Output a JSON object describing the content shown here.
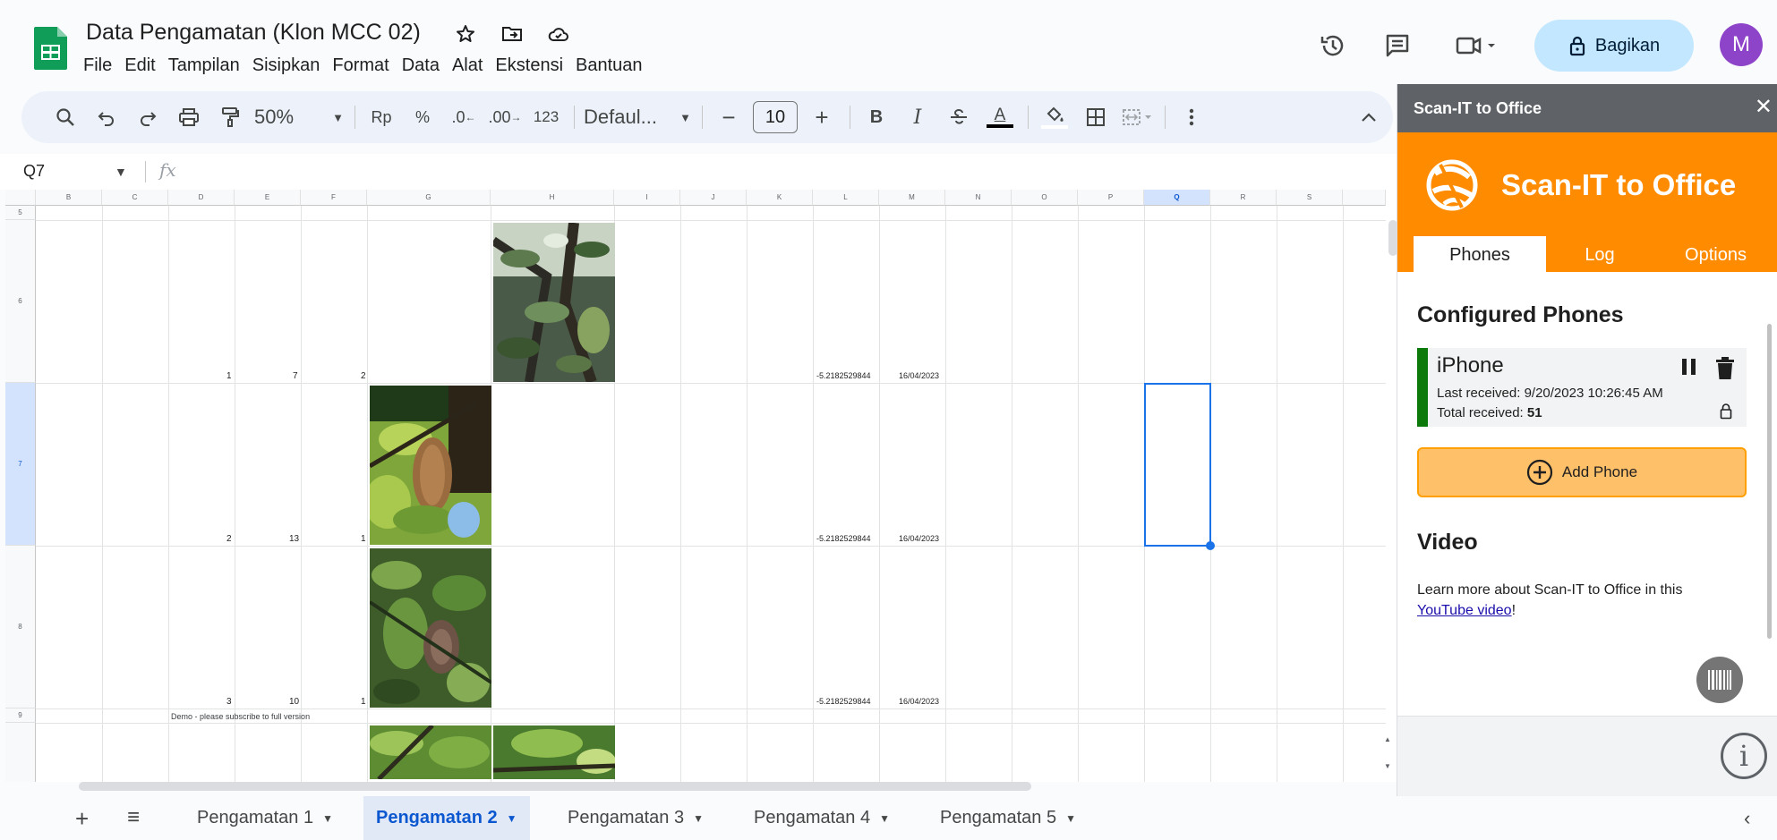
{
  "app": {
    "doc_title": "Data Pengamatan (Klon MCC 02)",
    "menu": [
      "File",
      "Edit",
      "Tampilan",
      "Sisipkan",
      "Format",
      "Data",
      "Alat",
      "Ekstensi",
      "Bantuan"
    ],
    "share_label": "Bagikan",
    "avatar_letter": "M",
    "brand_color": "#0f9d58"
  },
  "toolbar": {
    "zoom": "50%",
    "currency": "Rp",
    "percent": "%",
    "dec_decrease": ".0",
    "dec_increase": ".00",
    "number_format": "123",
    "font": "Defaul...",
    "font_size": "10",
    "bold": "B",
    "italic": "I",
    "text_color_letter": "A"
  },
  "formula_bar": {
    "name_box": "Q7",
    "fx": "fx"
  },
  "grid": {
    "columns": [
      "B",
      "C",
      "D",
      "E",
      "F",
      "G",
      "H",
      "I",
      "J",
      "K",
      "L",
      "M",
      "N",
      "O",
      "P",
      "Q",
      "R",
      "S"
    ],
    "rows": [
      "5",
      "6",
      "7",
      "8",
      "9"
    ],
    "row6": {
      "d": "1",
      "e": "7",
      "f": "2",
      "l": "-5.2182529844",
      "m": "16/04/2023"
    },
    "row7": {
      "d": "2",
      "e": "13",
      "f": "1",
      "l": "-5.2182529844",
      "m": "16/04/2023"
    },
    "row8": {
      "d": "3",
      "e": "10",
      "f": "1",
      "l": "-5.2182529844",
      "m": "16/04/2023"
    },
    "demo_note": "Demo - please subscribe to full version",
    "selected_cell": "Q7"
  },
  "sheets": {
    "tabs": [
      "Pengamatan 1",
      "Pengamatan 2",
      "Pengamatan 3",
      "Pengamatan 4",
      "Pengamatan 5"
    ],
    "active": "Pengamatan 2"
  },
  "panel": {
    "header": "Scan-IT to Office",
    "brand_title": "Scan-IT to Office",
    "brand_color": "#ff8c00",
    "tabs": [
      "Phones",
      "Log",
      "Options"
    ],
    "active_tab": "Phones",
    "configured_title": "Configured Phones",
    "phone": {
      "name": "iPhone",
      "last_received_label": "Last received:",
      "last_received": "9/20/2023 10:26:45 AM",
      "total_label": "Total received:",
      "total": "51"
    },
    "add_phone": "Add Phone",
    "video_title": "Video",
    "video_text": "Learn more about Scan-IT to Office in this",
    "video_link": "YouTube video",
    "video_end": "!"
  }
}
